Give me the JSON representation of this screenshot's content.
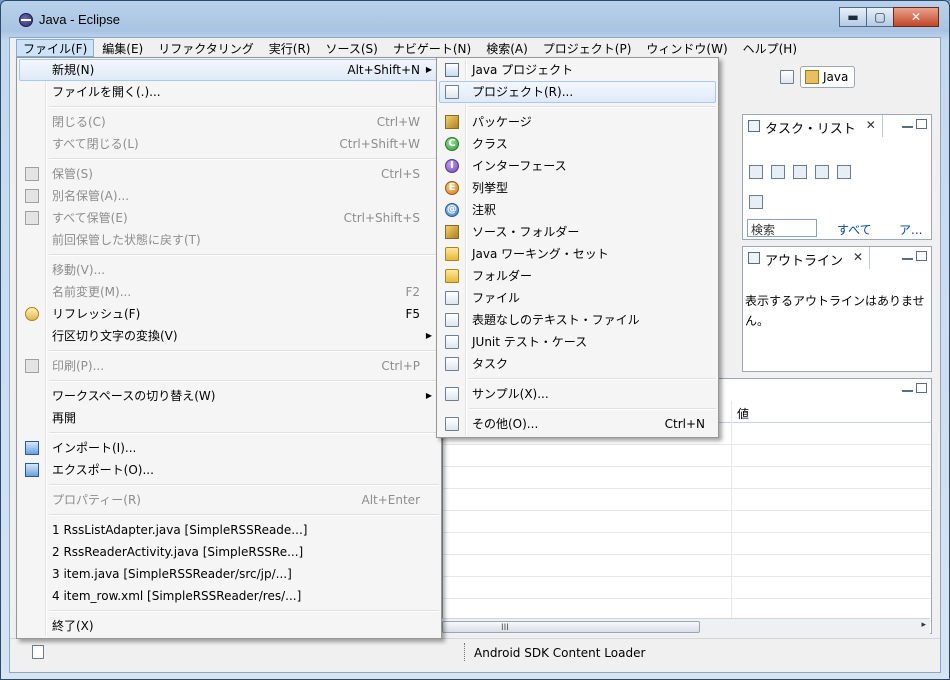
{
  "window": {
    "title": "Java - Eclipse",
    "minimize_glyph": "▬",
    "maximize_glyph": "▢",
    "close_glyph": "✕"
  },
  "menubar": {
    "items": [
      {
        "label": "ファイル(F)"
      },
      {
        "label": "編集(E)"
      },
      {
        "label": "リファクタリング"
      },
      {
        "label": "実行(R)"
      },
      {
        "label": "ソース(S)"
      },
      {
        "label": "ナビゲート(N)"
      },
      {
        "label": "検索(A)"
      },
      {
        "label": "プロジェクト(P)"
      },
      {
        "label": "ウィンドウ(W)"
      },
      {
        "label": "ヘルプ(H)"
      }
    ]
  },
  "perspective": {
    "label": "Java"
  },
  "task_view": {
    "title": "タスク・リスト",
    "search_placeholder": "検索",
    "link_all": "すべて",
    "link_a": "ア..."
  },
  "outline_view": {
    "title": "アウトライン",
    "message": "表示するアウトラインはありません。"
  },
  "props_view": {
    "value_header": "値"
  },
  "scrollbar": {
    "grip": "III",
    "right_arrow": "▸"
  },
  "status": {
    "text": "Android SDK Content Loader"
  },
  "file_menu": {
    "items": [
      {
        "label": "新規(N)",
        "shortcut": "Alt+Shift+N",
        "submenu": true
      },
      {
        "label": "ファイルを開く(.)..."
      },
      {
        "label": "閉じる(C)",
        "shortcut": "Ctrl+W",
        "disabled": true
      },
      {
        "label": "すべて閉じる(L)",
        "shortcut": "Ctrl+Shift+W",
        "disabled": true
      },
      {
        "label": "保管(S)",
        "shortcut": "Ctrl+S",
        "disabled": true
      },
      {
        "label": "別名保管(A)...",
        "disabled": true
      },
      {
        "label": "すべて保管(E)",
        "shortcut": "Ctrl+Shift+S",
        "disabled": true
      },
      {
        "label": "前回保管した状態に戻す(T)",
        "disabled": true
      },
      {
        "label": "移動(V)...",
        "disabled": true
      },
      {
        "label": "名前変更(M)...",
        "shortcut": "F2",
        "disabled": true
      },
      {
        "label": "リフレッシュ(F)",
        "shortcut": "F5"
      },
      {
        "label": "行区切り文字の変換(V)",
        "submenu": true
      },
      {
        "label": "印刷(P)...",
        "shortcut": "Ctrl+P",
        "disabled": true
      },
      {
        "label": "ワークスペースの切り替え(W)",
        "submenu": true
      },
      {
        "label": "再開"
      },
      {
        "label": "インポート(I)..."
      },
      {
        "label": "エクスポート(O)..."
      },
      {
        "label": "プロパティー(R)",
        "shortcut": "Alt+Enter",
        "disabled": true
      },
      {
        "label": "1 RssListAdapter.java  [SimpleRSSReade...]"
      },
      {
        "label": "2 RssReaderActivity.java  [SimpleRSSRe...]"
      },
      {
        "label": "3 item.java  [SimpleRSSReader/src/jp/...]"
      },
      {
        "label": "4 item_row.xml  [SimpleRSSReader/res/...]"
      },
      {
        "label": "終了(X)"
      }
    ],
    "submenu_arrow": "▶"
  },
  "new_menu": {
    "items": [
      {
        "label": "Java プロジェクト"
      },
      {
        "label": "プロジェクト(R)..."
      },
      {
        "label": "パッケージ"
      },
      {
        "label": "クラス"
      },
      {
        "label": "インターフェース"
      },
      {
        "label": "列挙型"
      },
      {
        "label": "注釈"
      },
      {
        "label": "ソース・フォルダー"
      },
      {
        "label": "Java ワーキング・セット"
      },
      {
        "label": "フォルダー"
      },
      {
        "label": "ファイル"
      },
      {
        "label": "表題なしのテキスト・ファイル"
      },
      {
        "label": "JUnit テスト・ケース"
      },
      {
        "label": "タスク"
      },
      {
        "label": "サンプル(X)..."
      },
      {
        "label": "その他(O)...",
        "shortcut": "Ctrl+N"
      }
    ],
    "icon_glyphs": {
      "class": "C",
      "interface": "I",
      "enum": "E",
      "annotation": "@"
    }
  }
}
